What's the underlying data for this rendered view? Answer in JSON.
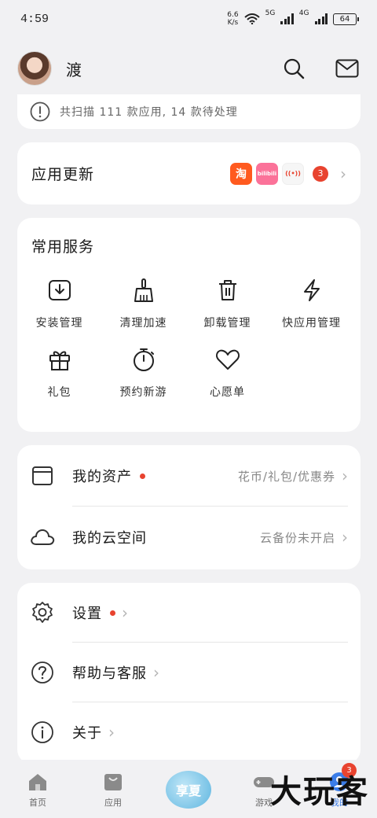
{
  "status_bar": {
    "time": "4:59",
    "speed_value": "6.6",
    "speed_unit": "K/s",
    "net1": "5G",
    "net2": "4G",
    "battery": "64"
  },
  "header": {
    "username": "渡",
    "icons": [
      "search-icon",
      "mail-icon"
    ]
  },
  "scan": {
    "text": "共扫描 111 款应用, 14 款待处理"
  },
  "update": {
    "title": "应用更新",
    "apps": [
      {
        "name": "淘",
        "color": "#ff5a1f"
      },
      {
        "name": "bilibili",
        "color": "#fb7299"
      },
      {
        "name": "((•))",
        "color": "#f6f6f6"
      }
    ],
    "count": "3"
  },
  "services": {
    "title": "常用服务",
    "items": [
      {
        "label": "安装管理",
        "icon": "install-icon"
      },
      {
        "label": "清理加速",
        "icon": "broom-icon"
      },
      {
        "label": "卸载管理",
        "icon": "trash-icon"
      },
      {
        "label": "快应用管理",
        "icon": "bolt-icon"
      },
      {
        "label": "礼包",
        "icon": "gift-icon"
      },
      {
        "label": "预约新游",
        "icon": "stopwatch-icon"
      },
      {
        "label": "心愿单",
        "icon": "heart-icon"
      }
    ]
  },
  "assets": {
    "rows": [
      {
        "label": "我的资产",
        "value": "花币/礼包/优惠券",
        "icon": "wallet-icon"
      },
      {
        "label": "我的云空间",
        "value": "云备份未开启",
        "icon": "cloud-icon"
      }
    ]
  },
  "settings": {
    "rows": [
      {
        "label": "设置",
        "icon": "gear-icon"
      },
      {
        "label": "帮助与客服",
        "icon": "help-icon"
      },
      {
        "label": "关于",
        "icon": "info-icon"
      }
    ]
  },
  "tabbar": {
    "tabs": [
      {
        "label": "首页",
        "icon": "home-icon"
      },
      {
        "label": "应用",
        "icon": "bag-icon"
      },
      {
        "label": "享夏",
        "icon": "promo-icon"
      },
      {
        "label": "游戏",
        "icon": "gamepad-icon"
      },
      {
        "label": "我的",
        "icon": "profile-icon"
      }
    ],
    "badge": "3"
  },
  "watermark": "大玩客"
}
